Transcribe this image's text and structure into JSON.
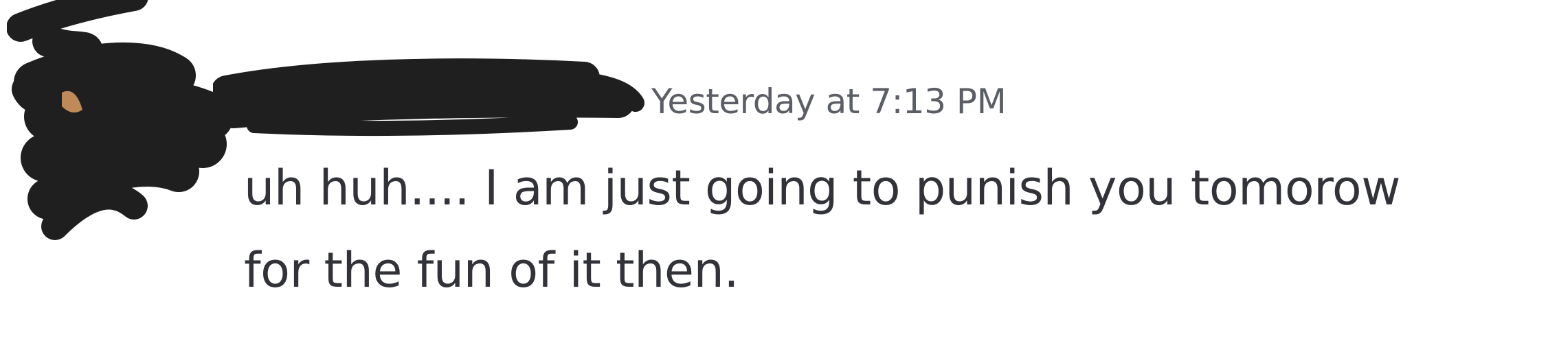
{
  "message": {
    "timestamp": "Yesterday at 7:13 PM",
    "content_lines": [
      "uh huh.... I am just going to punish you tomorow",
      "for the fun of it then."
    ]
  },
  "icons": {
    "avatar": "redacted-avatar-icon",
    "username": "redacted-username-scribble"
  },
  "colors": {
    "background": "#ffffff",
    "timestamp": "#5c5e66",
    "message_text": "#313338",
    "redaction": "#1f1f1f"
  }
}
